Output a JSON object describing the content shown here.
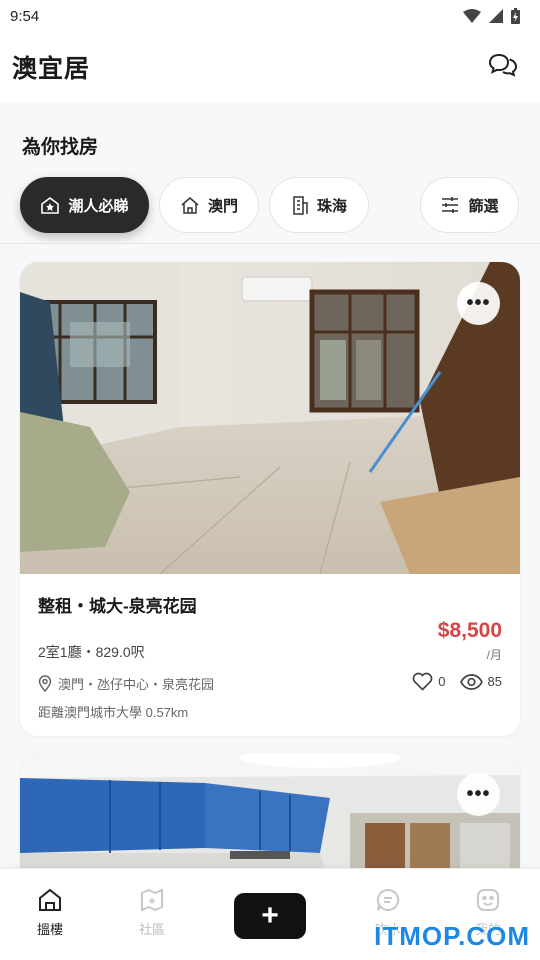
{
  "status_bar": {
    "time": "9:54"
  },
  "app": {
    "title": "澳宜居"
  },
  "section": {
    "title": "為你找房"
  },
  "filters": [
    {
      "label": "潮人必睇",
      "icon": "star-house-icon",
      "active": true
    },
    {
      "label": "澳門",
      "icon": "house-icon",
      "active": false
    },
    {
      "label": "珠海",
      "icon": "building-icon",
      "active": false
    },
    {
      "label": "篩選",
      "icon": "filter-sliders-icon",
      "active": false
    }
  ],
  "listings": [
    {
      "title": "整租・城大-泉亮花园",
      "price": "$8,500",
      "price_unit": "/月",
      "specs": "2室1廳・829.0呎",
      "location": "澳門・氹仔中心・泉亮花园",
      "likes": "0",
      "views": "85",
      "distance": "距離澳門城市大學 0.57km",
      "more": "•••"
    },
    {
      "more": "•••"
    }
  ],
  "tabs": [
    {
      "label": "搵樓",
      "icon": "home-icon",
      "active": true
    },
    {
      "label": "社區",
      "icon": "community-icon",
      "active": false
    },
    {
      "label": "",
      "icon": "plus-icon",
      "active": false
    },
    {
      "label": "吹水",
      "icon": "chat-icon",
      "active": false
    },
    {
      "label": "我的",
      "icon": "profile-icon",
      "active": false
    }
  ],
  "add_button": {
    "label": "+"
  },
  "watermark": {
    "text": "ITMOP.COM"
  },
  "colors": {
    "price": "#d64545",
    "accent_dark": "#2a2a2a",
    "watermark": "#1e88e5"
  }
}
